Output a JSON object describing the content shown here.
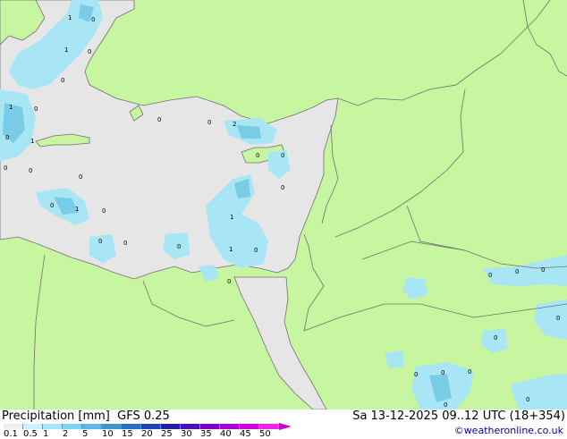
{
  "legend": {
    "title": "Precipitation [mm]",
    "model": "GFS 0.25",
    "scale_labels": [
      "0.1",
      "0.5",
      "1",
      "2",
      "5",
      "10",
      "15",
      "20",
      "25",
      "30",
      "35",
      "40",
      "45",
      "50"
    ],
    "scale_colors": [
      "#f0f0f0",
      "#c8f2ff",
      "#a0e6ff",
      "#7cd4f5",
      "#5ab8e6",
      "#3c96d2",
      "#2a6ec2",
      "#1e46b0",
      "#2020a0",
      "#4a10b4",
      "#7a00c8",
      "#a800d2",
      "#d000d8",
      "#e628e6"
    ]
  },
  "datetime": "Sa 13-12-2025 09..12 UTC (18+354)",
  "credit": "©weatheronline.co.uk",
  "colors": {
    "land": "#c8f5a0",
    "rain_area": "#e6e6e6",
    "light_precip": "#a8e6f5",
    "med_precip": "#78cce6",
    "border": "#707070",
    "coast": "#707070"
  },
  "point_labels": [
    "1",
    "0",
    "0",
    "1",
    "0",
    "0",
    "1",
    "0",
    "0",
    "2",
    "0",
    "1",
    "0",
    "0",
    "0",
    "0",
    "0",
    "1",
    "0",
    "1",
    "0",
    "0",
    "0",
    "0",
    "0",
    "1",
    "0",
    "0",
    "0",
    "0",
    "0",
    "0",
    "0",
    "0",
    "0",
    "0",
    "0",
    "0",
    "0",
    "0",
    "0",
    "0"
  ]
}
